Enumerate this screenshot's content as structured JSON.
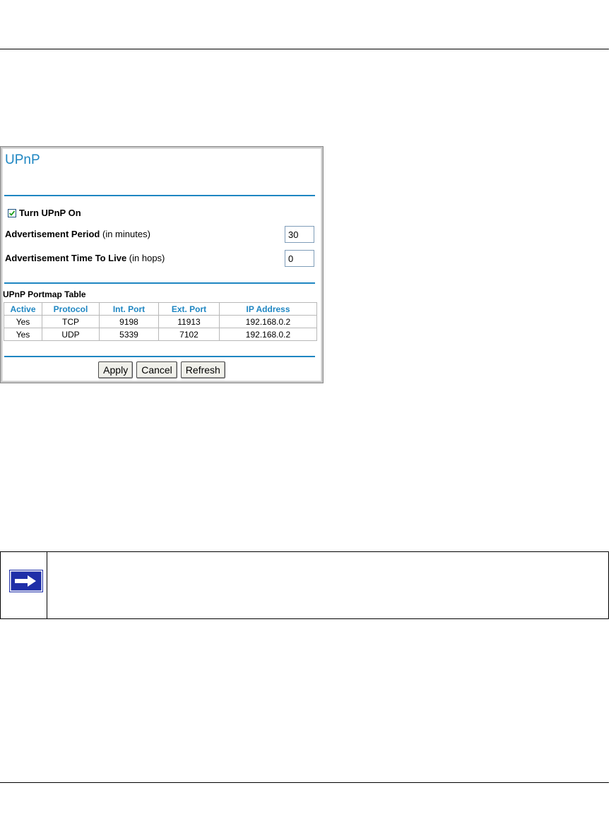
{
  "upnp_panel": {
    "title": "UPnP",
    "turn_on": {
      "label": "Turn UPnP On",
      "checked": true
    },
    "advertisement_period": {
      "label_bold": "Advertisement Period",
      "label_rest": " (in minutes)",
      "value": "30"
    },
    "advertisement_ttl": {
      "label_bold": "Advertisement Time To Live",
      "label_rest": " (in hops)",
      "value": "0"
    },
    "portmap": {
      "caption": "UPnP Portmap Table",
      "columns": [
        "Active",
        "Protocol",
        "Int. Port",
        "Ext. Port",
        "IP Address"
      ],
      "rows": [
        [
          "Yes",
          "TCP",
          "9198",
          "11913",
          "192.168.0.2"
        ],
        [
          "Yes",
          "UDP",
          "5339",
          "7102",
          "192.168.0.2"
        ]
      ]
    },
    "buttons": {
      "apply": "Apply",
      "cancel": "Cancel",
      "refresh": "Refresh"
    }
  },
  "note": {
    "icon": "arrow-right-icon",
    "text": ""
  },
  "colors": {
    "accent": "#1e86c2",
    "icon_blue": "#1f2fa8"
  }
}
